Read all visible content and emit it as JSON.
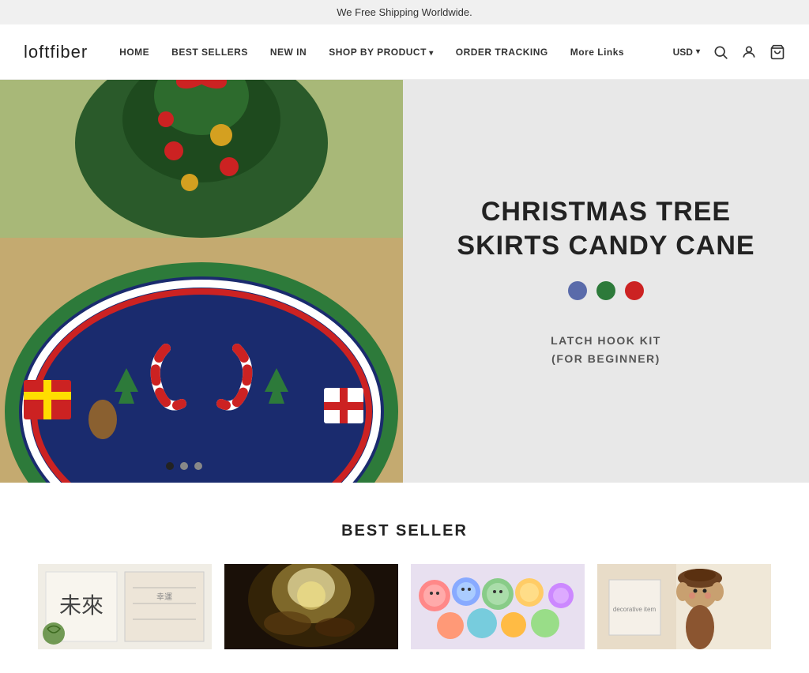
{
  "banner": {
    "text": "We Free Shipping Worldwide."
  },
  "header": {
    "logo": "loftfiber",
    "nav": [
      {
        "label": "HOME",
        "hasArrow": false
      },
      {
        "label": "BEST SELLERS",
        "hasArrow": false
      },
      {
        "label": "NEW IN",
        "hasArrow": false
      },
      {
        "label": "SHOP BY PRODUCT",
        "hasArrow": true
      },
      {
        "label": "ORDER TRACKING",
        "hasArrow": false
      },
      {
        "label": "More Links",
        "hasArrow": false
      }
    ],
    "currency": "USD",
    "icons": {
      "search": "🔍",
      "user": "👤",
      "cart": "🛒"
    }
  },
  "hero": {
    "title": "CHRISTMAS TREE SKIRTS CANDY CANE",
    "subtitle": "LATCH HOOK KIT\n(FOR BEGINNER)",
    "colors": [
      "#5a6baa",
      "#2d7a3a",
      "#cc2222"
    ],
    "dots": [
      {
        "active": true
      },
      {
        "active": false
      },
      {
        "active": false
      }
    ]
  },
  "best_seller": {
    "section_title": "BEST SELLER",
    "products": [
      {
        "id": 1,
        "alt": "Japanese calligraphy latch hook kit"
      },
      {
        "id": 2,
        "alt": "Warm light decorative product"
      },
      {
        "id": 3,
        "alt": "Colorful stuffed items collection"
      },
      {
        "id": 4,
        "alt": "Brown character doll product"
      }
    ]
  }
}
